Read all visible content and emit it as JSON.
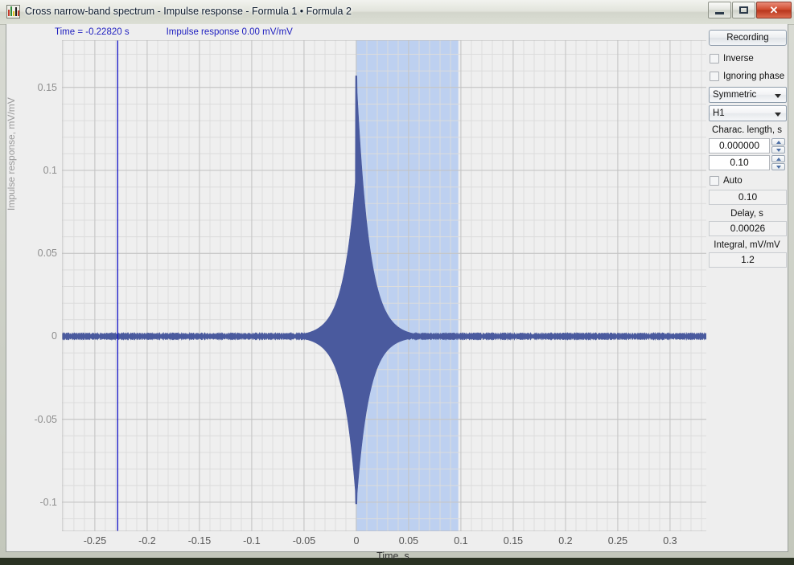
{
  "window": {
    "title": "Cross narrow-band spectrum - Impulse response - Formula 1 • Formula 2",
    "icon": "spectrum-icon",
    "minimize_label": "−",
    "maximize_label": "□",
    "close_label": "✕"
  },
  "readout": {
    "time": "Time = -0.22820 s",
    "value": "Impulse response 0.00 mV/mV"
  },
  "panel": {
    "recording_label": "Recording",
    "inverse_label": "Inverse",
    "ignoring_phase_label": "Ignoring phase",
    "symmetry_value": "Symmetric",
    "channel_value": "H1",
    "charac_length_label": "Charac. length, s",
    "charac_length_value": "0.000000",
    "charac_length_step": "0.10",
    "auto_label": "Auto",
    "auto_value": "0.10",
    "delay_label": "Delay, s",
    "delay_value": "0.00026",
    "integral_label": "Integral, mV/mV",
    "integral_value": "1.2"
  },
  "colors": {
    "trace": "#4a5a9e",
    "cursor": "#1414c8",
    "selection": "#bdd0f0",
    "readout_text": "#2020c0",
    "grid_minor": "#dcdcdc",
    "grid_major": "#c4c4c4",
    "plot_bg": "#efefef",
    "close_button": "#cf4a2d"
  },
  "chart_data": {
    "type": "line",
    "title": "",
    "xlabel": "Time, s",
    "ylabel": "Impulse response, mV/mV",
    "xlim": [
      -0.2815,
      0.3385
    ],
    "ylim": [
      -0.1175,
      0.1785
    ],
    "xticks": [
      -0.25,
      -0.2,
      -0.15,
      -0.1,
      -0.05,
      0,
      0.05,
      0.1,
      0.15,
      0.2,
      0.25,
      0.3
    ],
    "xticklabels": [
      "-0.25",
      "-0.2",
      "-0.15",
      "-0.1",
      "-0.05",
      "0",
      "0.05",
      "0.1",
      "0.15",
      "0.2",
      "0.25",
      "0.3"
    ],
    "yticks": [
      -0.1,
      -0.05,
      0,
      0.05,
      0.1,
      0.15
    ],
    "yticklabels": [
      "-0.1",
      "-0.05",
      "0",
      "0.05",
      "0.1",
      "0.15"
    ],
    "grid": true,
    "minor_grid": true,
    "legend": "none",
    "cursor_x": -0.2282,
    "cursor_value": 0.0,
    "selection_range": [
      -0.0005,
      0.0975
    ],
    "annotations": [
      {
        "text": "Time = -0.22820 s",
        "type": "readout"
      },
      {
        "text": "Impulse response 0.00 mV/mV",
        "type": "readout"
      }
    ],
    "series": [
      {
        "name": "Impulse response",
        "description": "Damped oscillatory impulse response centred at t=0; peak positive 0.157 mV/mV, peak negative -0.101 mV/mV, decaying envelope with ~0.04 s time constant, low-level noise elsewhere",
        "peak_positive": 0.157,
        "peak_negative": -0.101,
        "peak_time": 0.0,
        "decay_tau": 0.012,
        "baseline": 0.0,
        "noise_amplitude": 0.0022
      }
    ]
  }
}
